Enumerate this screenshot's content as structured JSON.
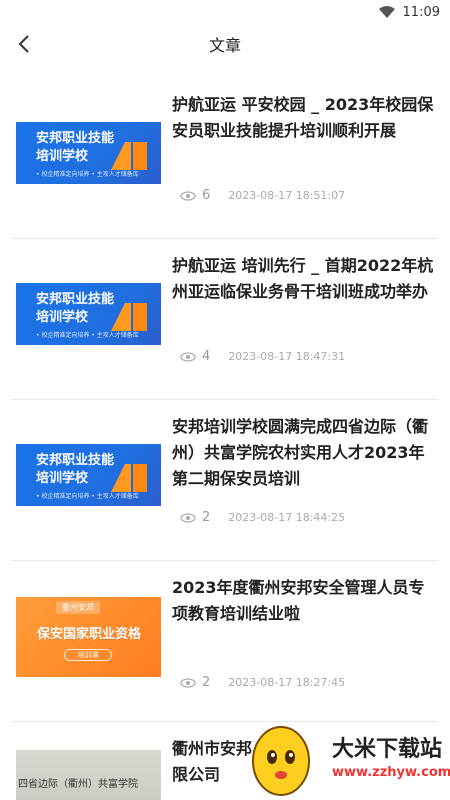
{
  "status": {
    "time": "11:09"
  },
  "header": {
    "title": "文章"
  },
  "articles": [
    {
      "title": "护航亚运 平安校园 _ 2023年校园保安员职业技能提升培训顺利开展",
      "views": "6",
      "date": "2023-08-17 18:51:07",
      "thumb": {
        "title": "安邦职业技能\n培训学校",
        "subtitle": "• 校企精准定向培养   • 主攻人才储备库"
      }
    },
    {
      "title": "护航亚运 培训先行 _ 首期2022年杭州亚运临保业务骨干培训班成功举办",
      "views": "4",
      "date": "2023-08-17 18:47:31",
      "thumb": {
        "title": "安邦职业技能\n培训学校",
        "subtitle": "• 校企精准定向培养   • 主攻人才储备库"
      }
    },
    {
      "title": "安邦培训学校圆满完成四省边际（衢州）共富学院农村实用人才2023年第二期保安员培训",
      "views": "2",
      "date": "2023-08-17 18:44:25",
      "thumb": {
        "title": "安邦职业技能\n培训学校",
        "subtitle": "• 校企精准定向培养   • 主攻人才储备库"
      }
    },
    {
      "title": "2023年度衢州安邦安全管理人员专项教育培训结业啦",
      "views": "2",
      "date": "2023-08-17 18:27:45",
      "thumb": {
        "badge": "衢州安邦",
        "title": "保安国家职业资格",
        "pill": "培训课"
      }
    },
    {
      "title": "衢州市安邦\n限公司",
      "thumb": {
        "photo_text": "四省边际（衢州）共富学院"
      }
    }
  ],
  "watermark": {
    "name": "大米下载站",
    "url": "www.zzhyw.com"
  },
  "colors": {
    "accent_blue": "#1a73e8",
    "orange": "#ff8a2a",
    "meta_gray": "#aaaaaa"
  }
}
